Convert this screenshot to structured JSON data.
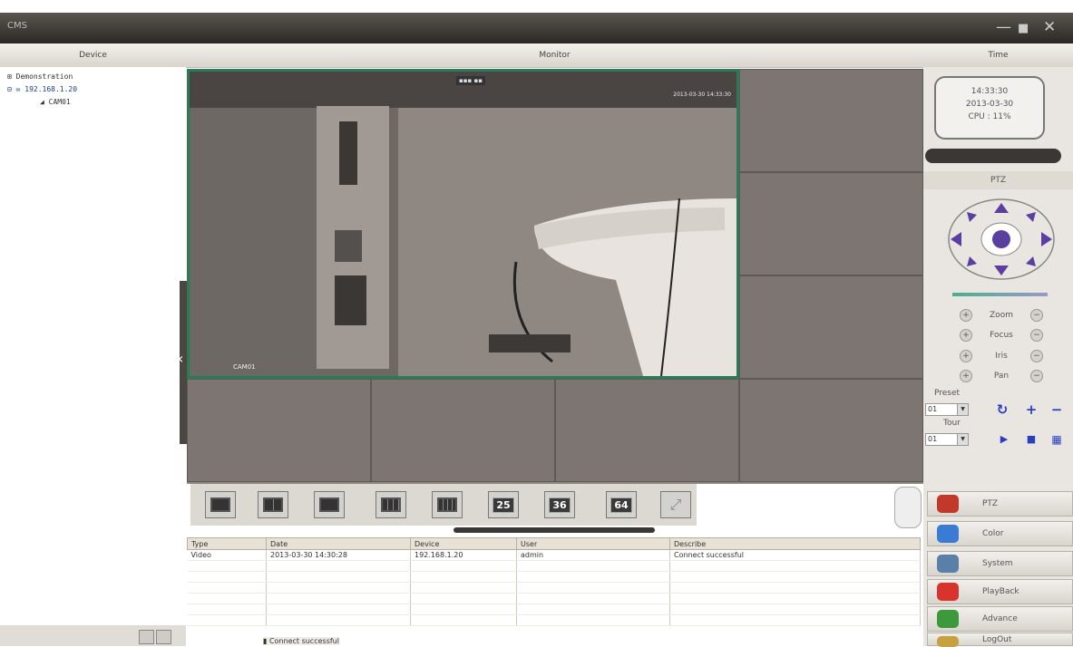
{
  "window": {
    "app_title": "CMS",
    "controls": [
      "—",
      "■",
      "✕"
    ]
  },
  "headers": {
    "device": "Device",
    "monitor": "Monitor",
    "time": "Time"
  },
  "device_tree": {
    "items": [
      {
        "label": "Demonstration",
        "prefix": "⊞ "
      },
      {
        "label": "192.168.1.20",
        "prefix": "⊟ ✉ "
      },
      {
        "label": "CAM01",
        "prefix": "◢ "
      }
    ]
  },
  "video": {
    "cam_label": "CAM01",
    "osd_time": "2013-03-30 14:33:30",
    "osd_top": "▪▪▪ ▪▪"
  },
  "layouts": {
    "buttons": [
      {
        "name": "layout-1",
        "label": ""
      },
      {
        "name": "layout-4",
        "label": ""
      },
      {
        "name": "layout-6",
        "label": ""
      },
      {
        "name": "layout-9",
        "label": ""
      },
      {
        "name": "layout-16",
        "label": ""
      },
      {
        "name": "layout-25",
        "label": "25"
      },
      {
        "name": "layout-36",
        "label": "36"
      },
      {
        "name": "layout-64",
        "label": "64"
      },
      {
        "name": "fullscreen",
        "label": ""
      }
    ]
  },
  "log": {
    "columns": [
      "Type",
      "Date",
      "Device",
      "User",
      "Describe"
    ],
    "rows": [
      [
        "Video",
        "2013-03-30 14:30:28",
        "192.168.1.20",
        "admin",
        "Connect successful"
      ]
    ],
    "status": "▮ Connect successful"
  },
  "time_panel": {
    "time": "14:33:30",
    "date": "2013-03-30",
    "cpu": "CPU : 11%"
  },
  "ptz": {
    "title": "PTZ",
    "controls": [
      "Zoom",
      "Focus",
      "Iris",
      "Pan"
    ],
    "preset_label": "Preset",
    "preset_value": "01",
    "tour_label": "Tour",
    "tour_value": "01"
  },
  "menu": {
    "items": [
      {
        "label": "PTZ",
        "color": "#c0392b"
      },
      {
        "label": "Color",
        "color": "#3a7bd5"
      },
      {
        "label": "System",
        "color": "#5a7fa8"
      },
      {
        "label": "PlayBack",
        "color": "#d9342b"
      },
      {
        "label": "Advance",
        "color": "#3c9a3c"
      },
      {
        "label": "LogOut",
        "color": "#c8a040"
      }
    ]
  },
  "colors": {
    "accent_border": "#2c7a55",
    "ptz_arrow": "#5a3fa0"
  }
}
